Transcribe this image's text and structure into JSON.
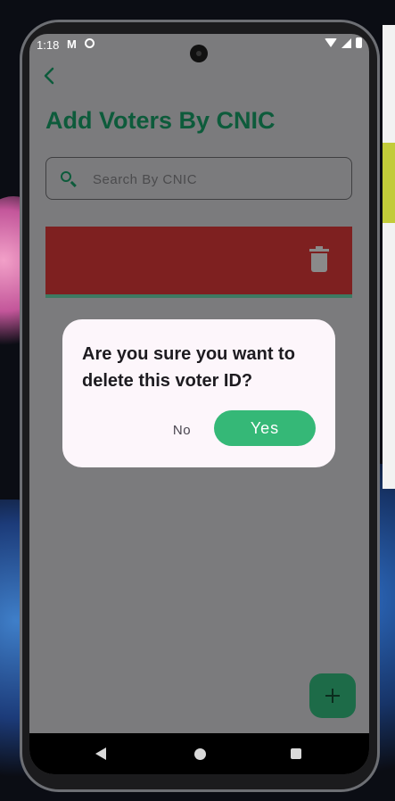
{
  "status_bar": {
    "time": "1:18",
    "left_icons": [
      "gmail-icon",
      "sync-icon"
    ],
    "right_icons": [
      "wifi-icon",
      "signal-icon",
      "battery-icon"
    ]
  },
  "header": {
    "back_icon": "chevron-left-icon",
    "title": "Add Voters By CNIC"
  },
  "search": {
    "placeholder": "Search By CNIC",
    "icon": "search-icon"
  },
  "voter_list": {
    "swipe_action_icon": "trash-icon",
    "swipe_color": "#7e2020"
  },
  "dialog": {
    "message": "Are you sure you want to delete this voter ID?",
    "no_label": "No",
    "yes_label": "Yes",
    "yes_color": "#35b877"
  },
  "fab": {
    "icon": "plus-icon"
  },
  "nav_bar": {
    "buttons": [
      "back-icon",
      "home-icon",
      "recents-icon"
    ]
  },
  "colors": {
    "primary": "#0d5b3b",
    "scrim": "#7b7b7d",
    "dialog_bg": "#fdf6fb"
  }
}
